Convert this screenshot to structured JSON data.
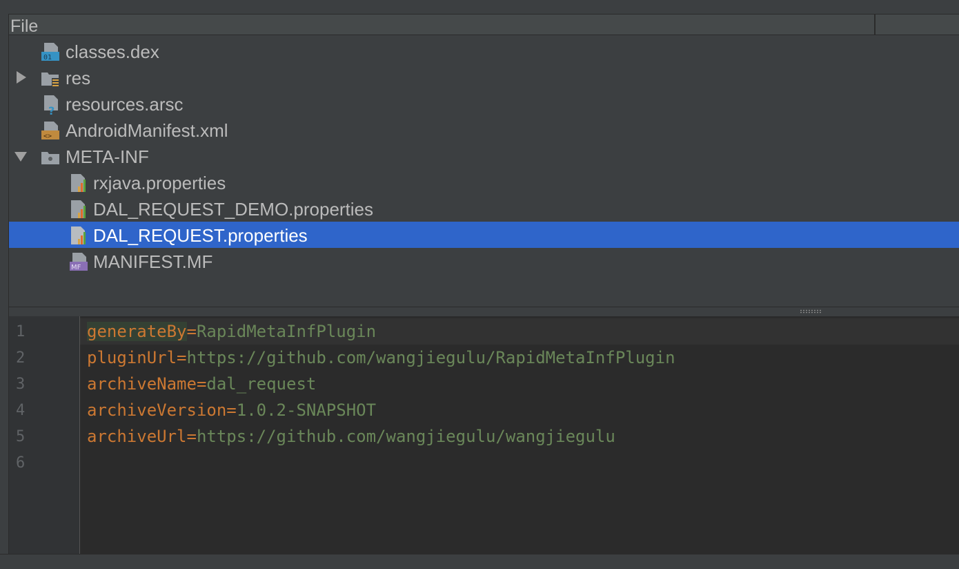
{
  "header": {
    "title": "File"
  },
  "tree": {
    "items": [
      {
        "label": "classes.dex",
        "icon": "dex-file-icon"
      },
      {
        "label": "res",
        "icon": "resource-folder-icon",
        "expander": "collapsed"
      },
      {
        "label": "resources.arsc",
        "icon": "unknown-file-icon"
      },
      {
        "label": "AndroidManifest.xml",
        "icon": "xml-file-icon"
      },
      {
        "label": "META-INF",
        "icon": "folder-icon",
        "expander": "expanded"
      },
      {
        "label": "rxjava.properties",
        "icon": "properties-file-icon"
      },
      {
        "label": "DAL_REQUEST_DEMO.properties",
        "icon": "properties-file-icon"
      },
      {
        "label": "DAL_REQUEST.properties",
        "icon": "properties-file-icon",
        "selected": true
      },
      {
        "label": "MANIFEST.MF",
        "icon": "manifest-file-icon"
      }
    ]
  },
  "editor": {
    "line_numbers": [
      "1",
      "2",
      "3",
      "4",
      "5",
      "6"
    ],
    "lines": [
      {
        "key": "generateBy",
        "sep": "=",
        "value": "RapidMetaInfPlugin"
      },
      {
        "key": "pluginUrl",
        "sep": "=",
        "value": "https://github.com/wangjiegulu/RapidMetaInfPlugin"
      },
      {
        "key": "archiveName",
        "sep": "=",
        "value": "dal_request"
      },
      {
        "key": "archiveVersion",
        "sep": "=",
        "value": "1.0.2-SNAPSHOT"
      },
      {
        "key": "archiveUrl",
        "sep": "=",
        "value": "https://github.com/wangjiegulu/wangjiegulu"
      },
      {
        "key": "",
        "sep": "",
        "value": ""
      }
    ]
  },
  "colors": {
    "selection": "#2f65ca",
    "key": "#cc7832",
    "value": "#6a8759",
    "editor_bg": "#2b2b2b",
    "panel_bg": "#3c3f41"
  }
}
